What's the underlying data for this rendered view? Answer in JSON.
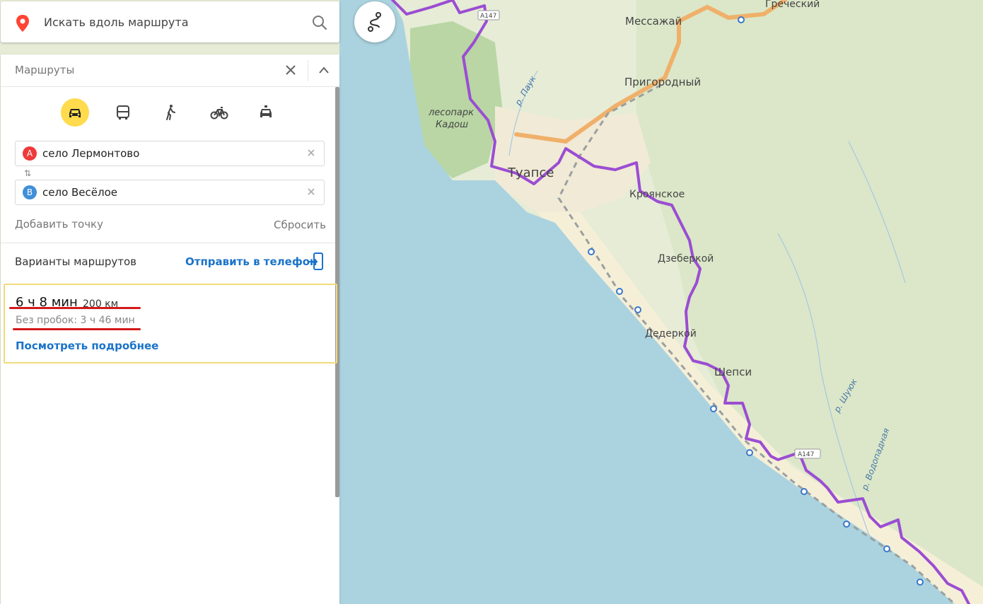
{
  "search": {
    "placeholder": "Искать вдоль маршрута"
  },
  "panel": {
    "title": "Маршруты",
    "modes": [
      "car",
      "bus",
      "walk",
      "bike",
      "taxi"
    ],
    "active_mode": "car",
    "point_a": {
      "badge": "A",
      "value": "село Лермонтово"
    },
    "point_b": {
      "badge": "B",
      "value": "село Весёлое"
    },
    "swap_glyph": "⇅",
    "add_point": "Добавить точку",
    "reset": "Сбросить",
    "variants_label": "Варианты маршрутов",
    "send_to_phone": "Отправить в телефон",
    "route": {
      "time": "6 ч 8 мин",
      "distance": "200 км",
      "without_traffic": "Без пробок: 3 ч 46 мин",
      "details_link": "Посмотреть подробнее"
    }
  },
  "map": {
    "labels": {
      "tuapse": "Туапсе",
      "messazhay": "Мессажай",
      "grecheskiy": "Греческий",
      "prigorodny": "Пригородный",
      "lesopark_1": "лесопарк",
      "lesopark_2": "Кадош",
      "river_pauk": "р. Паук",
      "kryanskoe": "Кроянское",
      "dzhebergoy": "Дзеберкой",
      "dederkoy": "Дедеркой",
      "shepsi": "Шепси",
      "river_shuyuk": "р. Шуюк",
      "river_vodopadnaya": "р. Водопадная",
      "road_a147": "А147"
    }
  },
  "colors": {
    "route": "#9b4dd2",
    "sea": "#aad3df",
    "accent": "#ffdb4d",
    "link": "#1a73c9",
    "underline": "#d31a1a",
    "badge_a": "#ef3a3a",
    "badge_b": "#3f8fd9"
  }
}
